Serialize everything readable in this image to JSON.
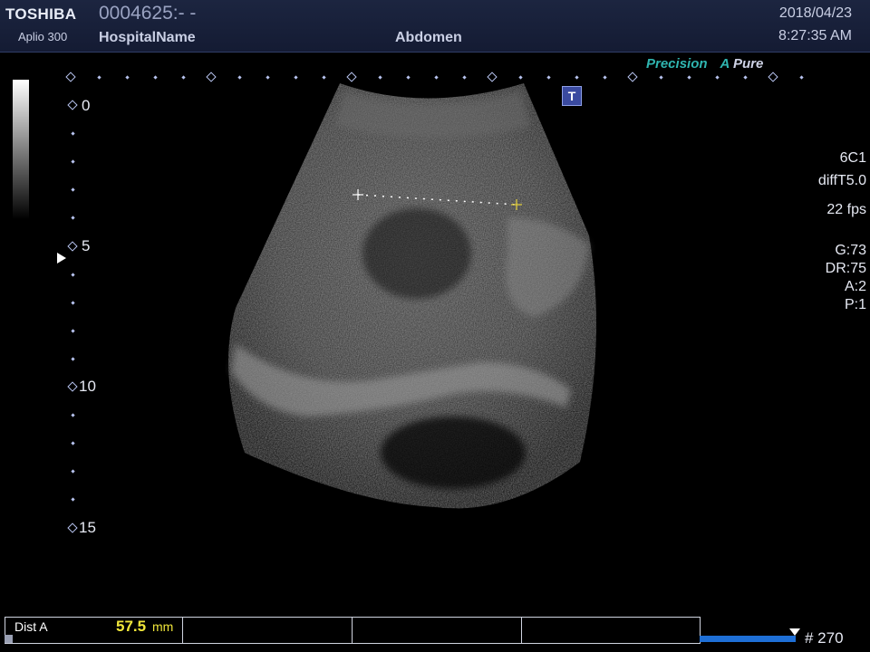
{
  "header": {
    "brand": "TOSHIBA",
    "model": "Aplio 300",
    "patient_id": "0004625:- -",
    "hospital": "HospitalName",
    "exam": "Abdomen",
    "date": "2018/04/23",
    "time": "8:27:35 AM"
  },
  "modes": {
    "precision": "Precision",
    "apure_a": "A",
    "apure_rest": "Pure"
  },
  "depth_labels": {
    "d0": "0",
    "d5": "5",
    "d10": "10",
    "d15": "15"
  },
  "t_icon": "T",
  "params": {
    "probe": "6C1",
    "preset": "diffT5.0",
    "fps": "22 fps",
    "gain": "G:73",
    "dr": "DR:75",
    "a": "A:2",
    "p": "P:1"
  },
  "measurement": {
    "label": "Dist A",
    "value": "57.5",
    "unit": "mm"
  },
  "frame": "# 270",
  "colors": {
    "accent": "#2fb5b0",
    "measure": "#f0e63a",
    "scale": "#b8c4f0",
    "cine": "#1e6fd6"
  }
}
